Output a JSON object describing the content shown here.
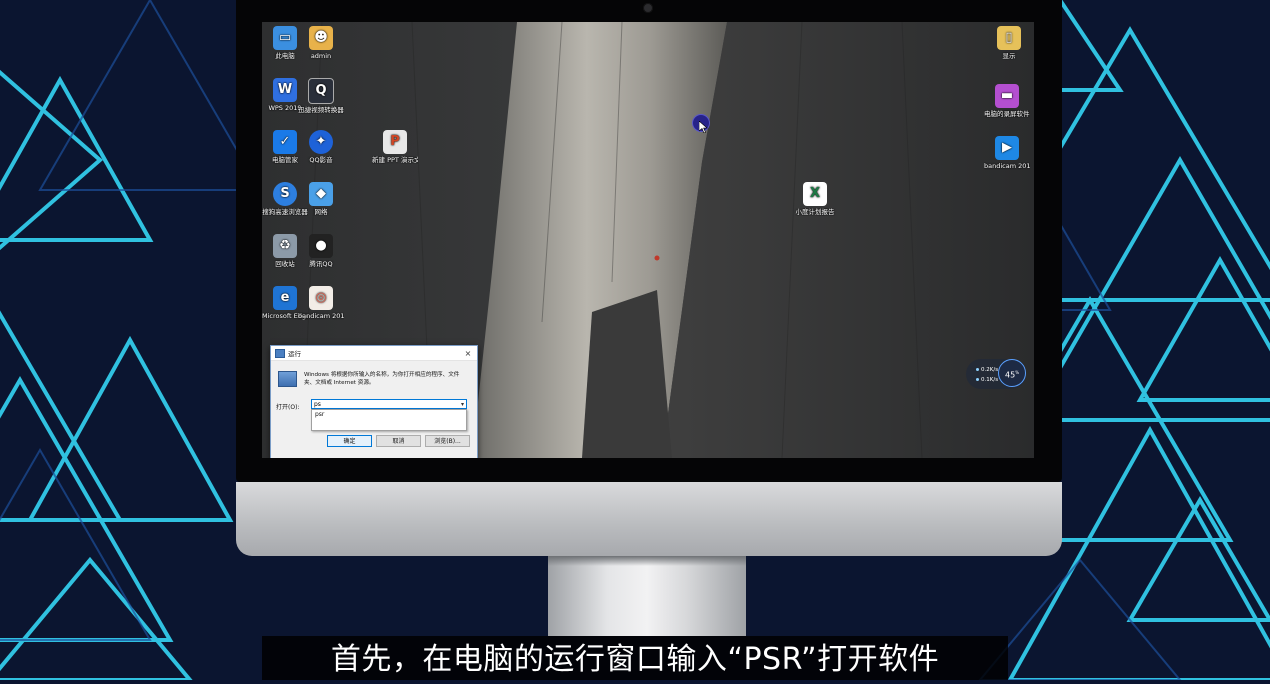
{
  "desktop_icons": [
    {
      "label": "此电脑",
      "icon": "this-pc-icon",
      "color": "#3b8fe0"
    },
    {
      "label": "admin",
      "icon": "user-folder-icon",
      "color": "#e8b24a"
    },
    {
      "label": "WPS 2019",
      "icon": "wps-icon",
      "color": "#2f6fe0"
    },
    {
      "label": "迅捷视频转换器",
      "icon": "video-converter-icon",
      "color": "#2a2f3a"
    },
    {
      "label": "电脑管家",
      "icon": "pc-manager-icon",
      "color": "#1a7ae8"
    },
    {
      "label": "QQ影音",
      "icon": "qq-player-icon",
      "color": "#1e62d8"
    },
    {
      "label": "新建 PPT 演示文稿",
      "icon": "ppt-file-icon",
      "color": "#e8e8e8"
    },
    {
      "label": "搜狗高速浏览器",
      "icon": "sogou-browser-icon",
      "color": "#2d7fe0"
    },
    {
      "label": "网络",
      "icon": "network-icon",
      "color": "#4aa0e8"
    },
    {
      "label": "回收站",
      "icon": "recycle-bin-icon",
      "color": "#8c9aa8"
    },
    {
      "label": "腾讯QQ",
      "icon": "qq-icon",
      "color": "#222222"
    },
    {
      "label": "Microsoft Edge",
      "icon": "edge-icon",
      "color": "#1f74d4"
    },
    {
      "label": "bandicam 2019-12-...",
      "icon": "bandicam-file-icon",
      "color": "#f2ede7"
    },
    {
      "label": "小度计划报告",
      "icon": "excel-file-icon",
      "color": "#ffffff"
    },
    {
      "label": "显示",
      "icon": "folder-icon",
      "color": "#e6c15a"
    },
    {
      "label": "电脑的录屏软件哪个好...",
      "icon": "screen-record-icon",
      "color": "#b44fd0"
    },
    {
      "label": "bandicam 2019-12-0...",
      "icon": "bandicam-video-icon",
      "color": "#1e88e5"
    }
  ],
  "run_dialog": {
    "title": "运行",
    "close_glyph": "×",
    "description": "Windows 将根据你所输入的名称，为你打开相应的程序、文件夹、文档或 Internet 资源。",
    "open_label": "打开(O):",
    "input_value": "ps",
    "autocomplete_suggestion": "psr",
    "dropdown_glyph": "▾",
    "ok_label": "确定",
    "cancel_label": "取消",
    "browse_label": "浏览(B)..."
  },
  "net_widget": {
    "upload": "0.2K/s",
    "download": "0.1K/s",
    "percent": "45",
    "percent_unit": "%"
  },
  "subtitle": "首先，在电脑的运行窗口输入“PSR”打开软件"
}
